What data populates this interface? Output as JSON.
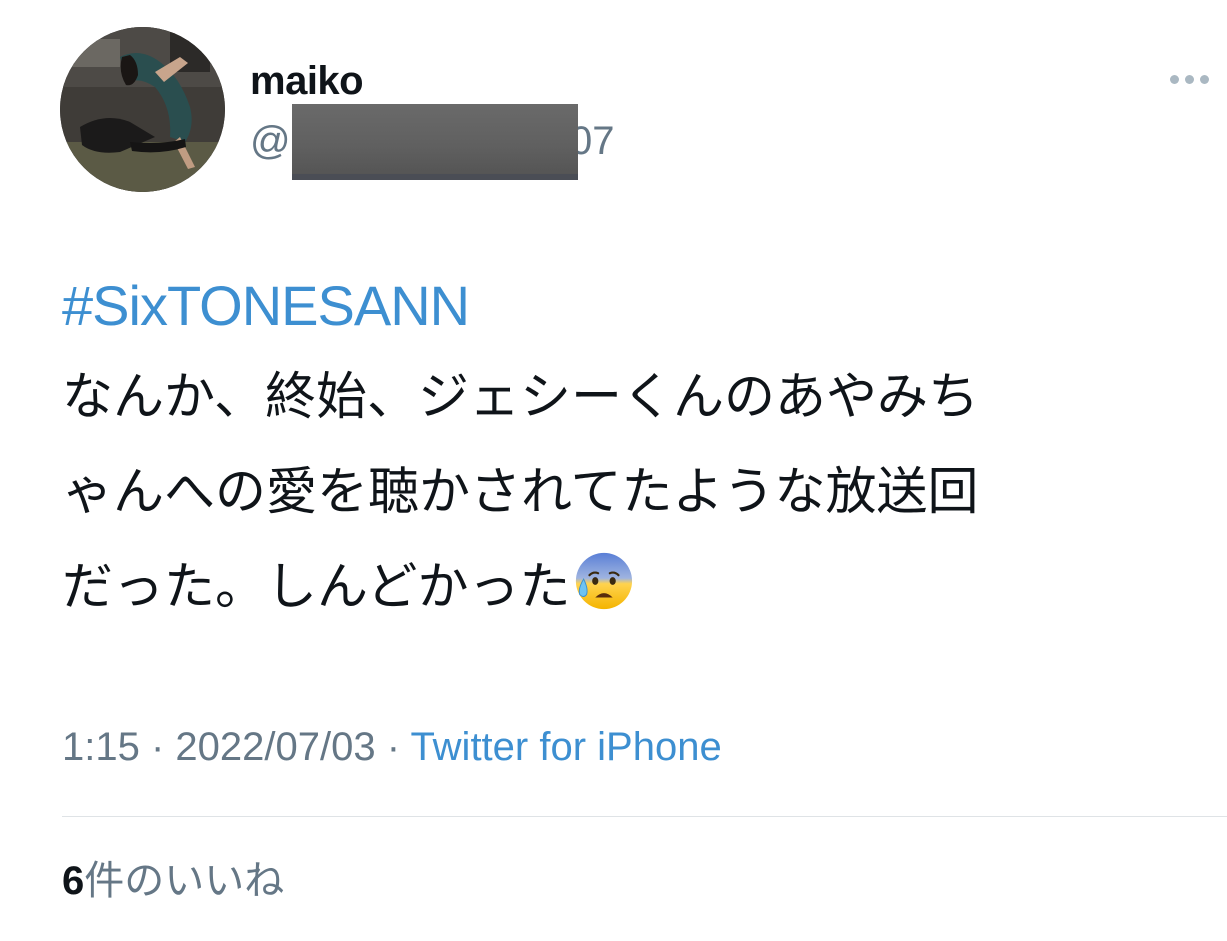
{
  "tweet": {
    "user": {
      "display_name": "maiko",
      "handle_prefix": "@",
      "handle_suffix": "07",
      "avatar_icon": "user-avatar-photo"
    },
    "more_icon": "more-dots-icon",
    "hashtag": "#SixTONESANN",
    "text_lines": [
      "なんか、終始、ジェシーくんのあやみち",
      "ゃんへの愛を聴かされてたような放送回",
      "だった。しんどかった"
    ],
    "emoji_icon": "anxious-face-with-sweat-icon",
    "time": "1:15",
    "separator": " · ",
    "date": "2022/07/03",
    "source": "Twitter for iPhone",
    "likes_count": "6",
    "likes_label": "件のいいね"
  },
  "colors": {
    "link": "#3d8fd1",
    "secondary_text": "#657786",
    "primary_text": "#0f1419",
    "divider": "#dfe3e6"
  }
}
